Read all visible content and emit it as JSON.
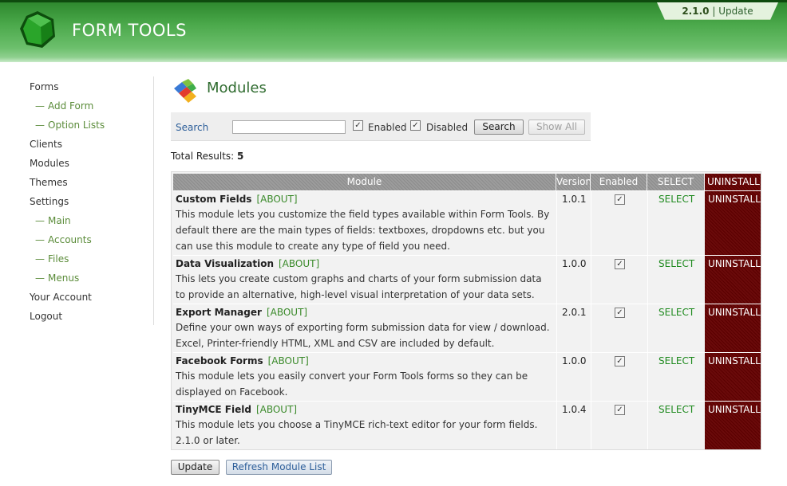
{
  "header": {
    "app_title": "FORM TOOLS",
    "version": "2.1.0",
    "separator": "|",
    "update_label": "Update"
  },
  "sidebar": {
    "items": [
      {
        "label": "Forms",
        "sub": false
      },
      {
        "label": "Add Form",
        "sub": true
      },
      {
        "label": "Option Lists",
        "sub": true
      },
      {
        "label": "Clients",
        "sub": false
      },
      {
        "label": "Modules",
        "sub": false
      },
      {
        "label": "Themes",
        "sub": false
      },
      {
        "label": "Settings",
        "sub": false
      },
      {
        "label": "Main",
        "sub": true
      },
      {
        "label": "Accounts",
        "sub": true
      },
      {
        "label": "Files",
        "sub": true
      },
      {
        "label": "Menus",
        "sub": true
      },
      {
        "label": "Your Account",
        "sub": false
      },
      {
        "label": "Logout",
        "sub": false
      }
    ],
    "sub_prefix": "—"
  },
  "page": {
    "title": "Modules",
    "icon": "modules-icon"
  },
  "search": {
    "label": "Search",
    "value": "",
    "enabled_label": "Enabled",
    "enabled_checked": true,
    "disabled_label": "Disabled",
    "disabled_checked": true,
    "search_button": "Search",
    "show_all_button": "Show All"
  },
  "results": {
    "label": "Total Results:",
    "count": "5"
  },
  "table": {
    "headers": {
      "module": "Module",
      "version": "Version",
      "enabled": "Enabled",
      "select": "SELECT",
      "uninstall": "UNINSTALL"
    },
    "rows": [
      {
        "name": "Custom Fields",
        "about": "[ABOUT]",
        "description": "This module lets you customize the field types available within Form Tools. By default there are the main types of fields: textboxes, dropdowns etc. but you can use this module to create any type of field you need.",
        "version": "1.0.1",
        "enabled": true,
        "select": "SELECT",
        "uninstall": "UNINSTALL"
      },
      {
        "name": "Data Visualization",
        "about": "[ABOUT]",
        "description": "This lets you create custom graphs and charts of your form submission data to provide an alternative, high-level visual interpretation of your data sets.",
        "version": "1.0.0",
        "enabled": true,
        "select": "SELECT",
        "uninstall": "UNINSTALL"
      },
      {
        "name": "Export Manager",
        "about": "[ABOUT]",
        "description": "Define your own ways of exporting form submission data for view / download. Excel, Printer-friendly HTML, XML and CSV are included by default.",
        "version": "2.0.1",
        "enabled": true,
        "select": "SELECT",
        "uninstall": "UNINSTALL"
      },
      {
        "name": "Facebook Forms",
        "about": "[ABOUT]",
        "description": "This module lets you easily convert your Form Tools forms so they can be displayed on Facebook.",
        "version": "1.0.0",
        "enabled": true,
        "select": "SELECT",
        "uninstall": "UNINSTALL"
      },
      {
        "name": "TinyMCE Field",
        "about": "[ABOUT]",
        "description": "This module lets you choose a TinyMCE rich-text editor for your form fields. 2.1.0 or later.",
        "version": "1.0.4",
        "enabled": true,
        "select": "SELECT",
        "uninstall": "UNINSTALL"
      }
    ]
  },
  "footer_buttons": {
    "update": "Update",
    "refresh": "Refresh Module List"
  },
  "colors": {
    "header_green": "#4aa84a",
    "link_green": "#3a8a2a",
    "uninstall_red": "#5a0000",
    "search_blue": "#2d5f9a"
  }
}
